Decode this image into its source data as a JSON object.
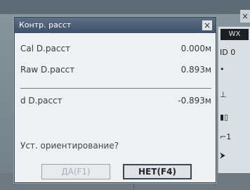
{
  "background": {
    "right_panel": {
      "badge": "WX",
      "items": [
        "ID",
        "0",
        "•",
        "┴•",
        "▐█",
        "┐‥",
        "→"
      ]
    }
  },
  "dialog": {
    "title": "Контр. расст",
    "rows": [
      {
        "label": "Cal D.расст",
        "value": "0.000м"
      },
      {
        "label": "Raw D.расст",
        "value": "0.893м"
      },
      {
        "label": "d D.расст",
        "value": "-0.893м"
      }
    ],
    "prompt": "Уст. ориентирование?",
    "buttons": {
      "yes_label": "ДА(F1)",
      "no_label": "НЕТ(F4)"
    }
  },
  "colors": {
    "title_bar": "#4c5f77",
    "dialog_bg": "#eef1f2",
    "accent_border": "#3b4a56"
  }
}
